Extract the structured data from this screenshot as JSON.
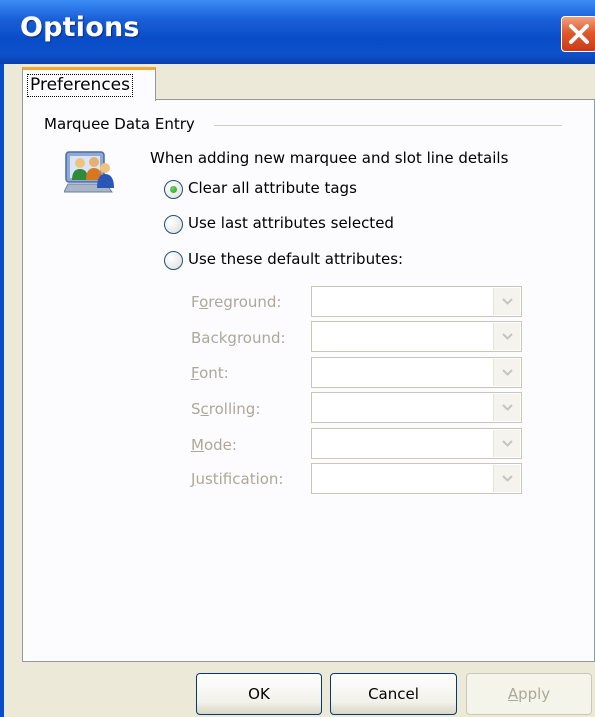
{
  "window": {
    "title": "Options"
  },
  "tabs": [
    {
      "label": "Preferences",
      "selected": true
    }
  ],
  "group": {
    "label": "Marquee Data Entry",
    "intro": "When adding new marquee and slot line details",
    "icon": "users-monitor-icon"
  },
  "radios": [
    {
      "label": "Clear all attribute tags",
      "checked": true
    },
    {
      "label": "Use last attributes selected",
      "checked": false
    },
    {
      "label": "Use these default attributes:",
      "checked": false
    }
  ],
  "fields": [
    {
      "label": "Foreground:",
      "mnemonic": "o",
      "value": "",
      "enabled": false
    },
    {
      "label": "Background:",
      "mnemonic": "g",
      "value": "",
      "enabled": false
    },
    {
      "label": "Font:",
      "mnemonic": "F",
      "value": "",
      "enabled": false
    },
    {
      "label": "Scrolling:",
      "mnemonic": "c",
      "value": "",
      "enabled": false
    },
    {
      "label": "Mode:",
      "mnemonic": "M",
      "value": "",
      "enabled": false
    },
    {
      "label": "Justification:",
      "mnemonic": "J",
      "value": "",
      "enabled": false
    }
  ],
  "buttons": {
    "ok": "OK",
    "cancel": "Cancel",
    "apply": "Apply",
    "apply_mnemonic": "A",
    "apply_enabled": false
  },
  "colors": {
    "titlebar": "#0a4cc8",
    "close": "#e05a2c",
    "tab_highlight": "#f3a737",
    "disabled_text": "#aca899"
  }
}
